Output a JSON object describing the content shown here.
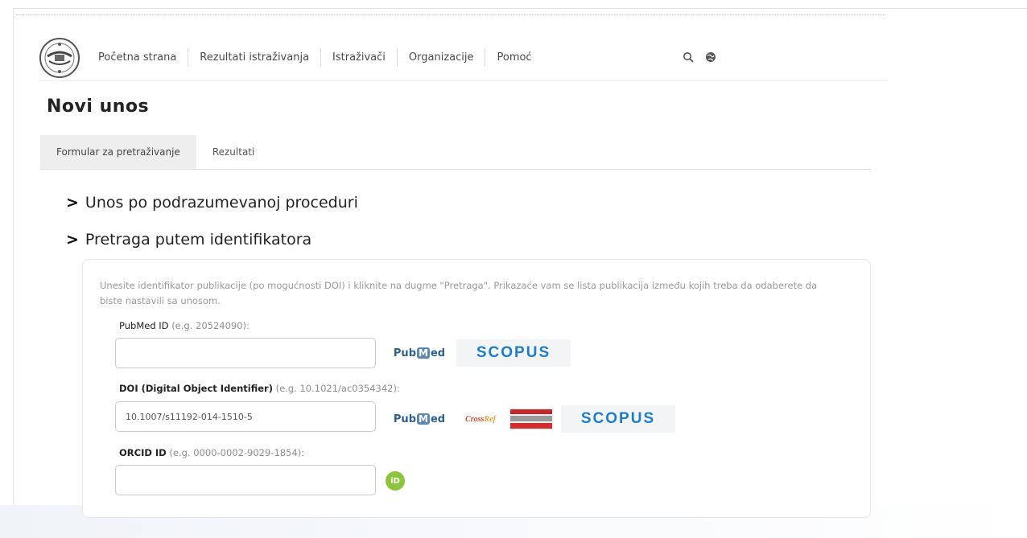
{
  "nav": {
    "items": [
      "Početna strana",
      "Rezultati istraživanja",
      "Istraživači",
      "Organizacije",
      "Pomoć"
    ]
  },
  "page": {
    "title": "Novi unos"
  },
  "tabs": [
    {
      "label": "Formular za pretraživanje",
      "active": true
    },
    {
      "label": "Rezultati",
      "active": false
    }
  ],
  "sections": {
    "default_procedure": "Unos po podrazumevanoj proceduri",
    "identifier_search": "Pretraga putem identifikatora"
  },
  "form": {
    "description": "Unesite identifikator publikacije (po mogućnosti DOI) i kliknite na dugme \"Pretraga\". Prikazaće vam se lista publikacija između kojih treba da odaberete da biste nastavili sa unosom.",
    "pubmed": {
      "label": "PubMed ID",
      "hint": "(e.g. 20524090):",
      "value": ""
    },
    "doi": {
      "label": "DOI (Digital Object Identifier)",
      "hint": "(e.g. 10.1021/ac0354342):",
      "value": "10.1007/s11192-014-1510-5"
    },
    "orcid": {
      "label": "ORCID ID",
      "hint": "(e.g. 0000-0002-9029-1854):",
      "value": ""
    }
  },
  "providers": {
    "pubmed_prefix": "Pub",
    "pubmed_mark": "M",
    "pubmed_suffix": "ed",
    "scopus": "SCOPUS",
    "crossref_a": "Cross",
    "crossref_b": "Ref",
    "orcid": "iD"
  },
  "colors": {
    "scopus_blue": "#1f7dc8",
    "pubmed_blue": "#2c5f8a",
    "orcid_green": "#8cc43c",
    "crossref_red": "#d0462c",
    "tab_active_bg": "#eeeeee"
  },
  "icons": {
    "logo": "university-seal-icon",
    "search": "search-icon",
    "language": "globe-icon",
    "chevron": "chevron-right-icon"
  }
}
